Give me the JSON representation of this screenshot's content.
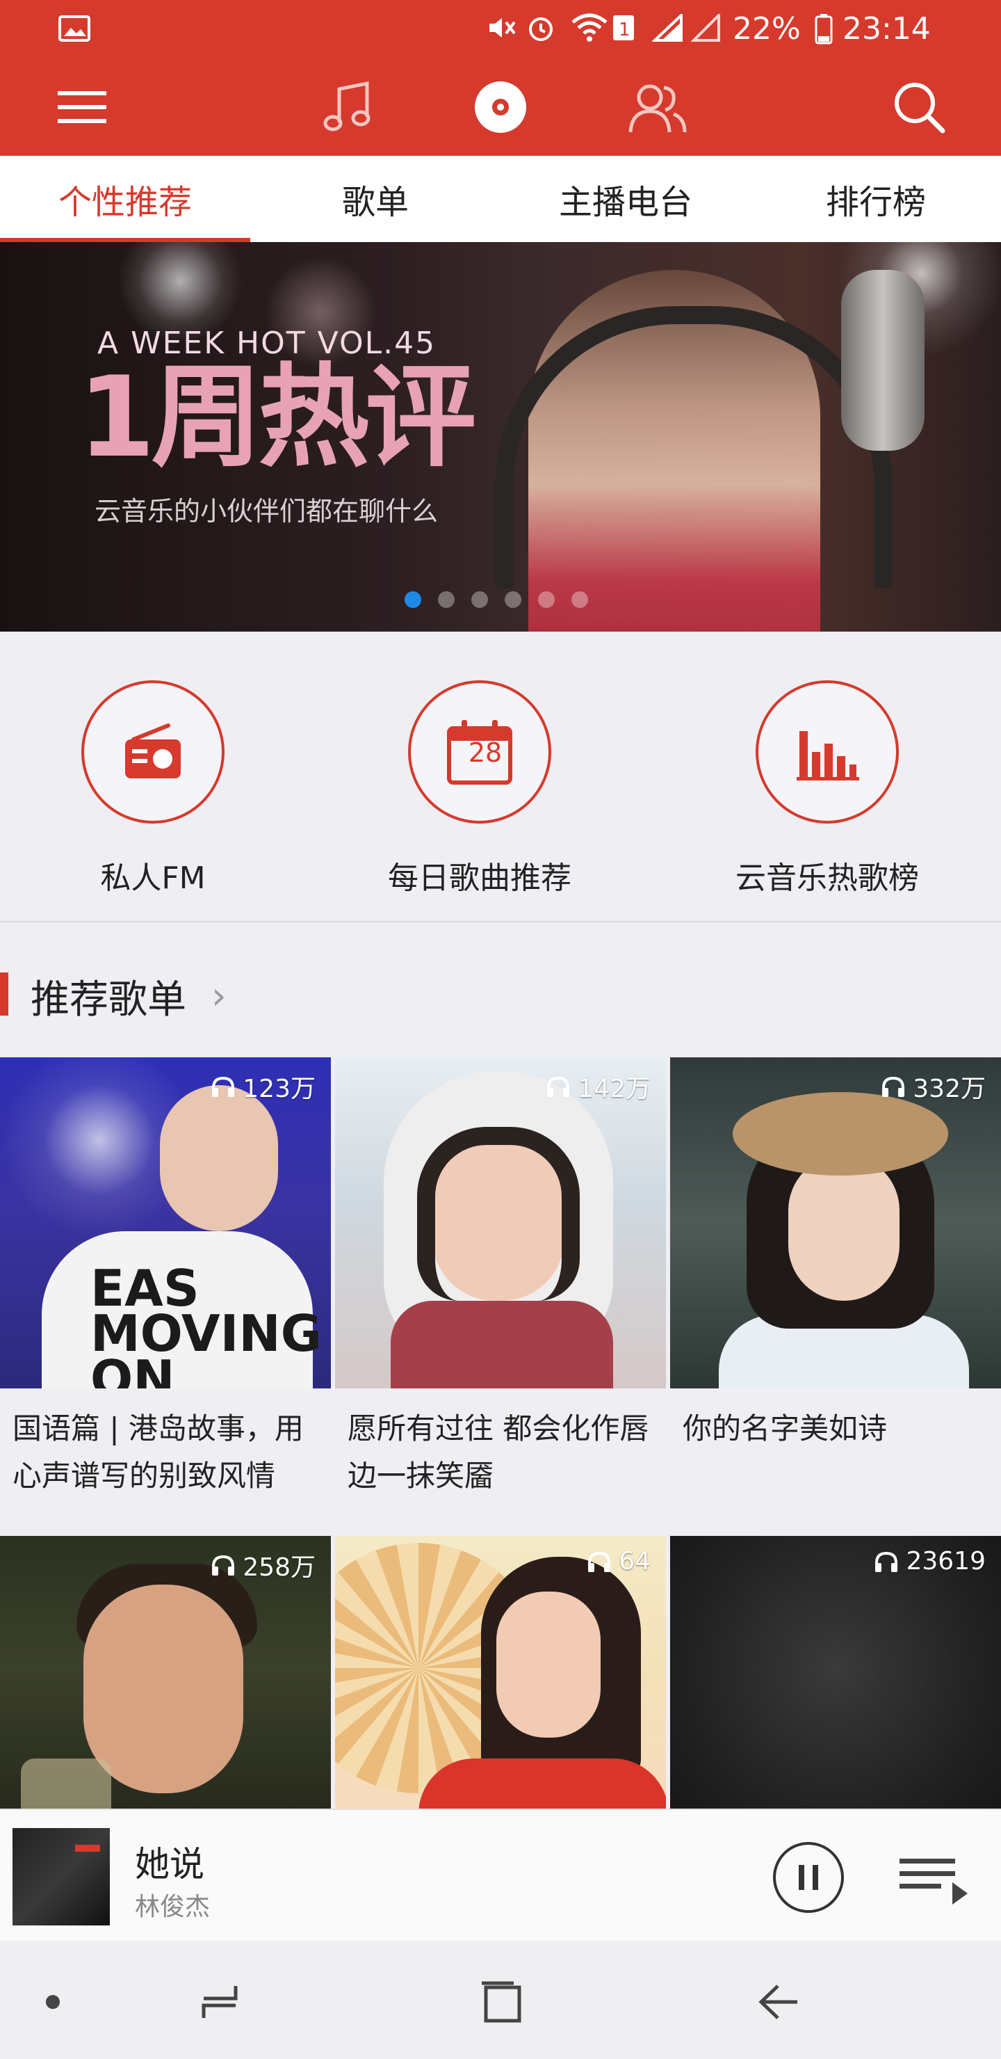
{
  "status_bar": {
    "battery_text": "22%",
    "time": "23:14",
    "icons": [
      "gallery-icon",
      "mute-icon",
      "alarm-icon",
      "wifi-icon",
      "sim1-icon",
      "signal-icon",
      "signal2-icon",
      "battery-icon"
    ]
  },
  "appbar": {
    "icons": [
      "menu-icon",
      "music-note-icon",
      "disc-icon",
      "friends-icon",
      "search-icon"
    ]
  },
  "tabs": [
    {
      "label": "个性推荐",
      "active": true
    },
    {
      "label": "歌单",
      "active": false
    },
    {
      "label": "主播电台",
      "active": false
    },
    {
      "label": "排行榜",
      "active": false
    }
  ],
  "banner": {
    "vol_text": "A WEEK HOT  VOL.45",
    "headline": "1周热评",
    "subtitle": "云音乐的小伙伴们都在聊什么",
    "page_count": 6,
    "active_page": 1
  },
  "quick_actions": [
    {
      "label": "私人FM",
      "icon": "radio-icon"
    },
    {
      "label": "每日歌曲推荐",
      "icon": "calendar-icon",
      "calendar_day": "28"
    },
    {
      "label": "云音乐热歌榜",
      "icon": "chart-bars-icon"
    }
  ],
  "section": {
    "title": "推荐歌单"
  },
  "playlists": [
    {
      "plays": "123万",
      "title": "国语篇 | 港岛故事，用心声谱写的别致风情",
      "art_text": "EAS MOVING ON"
    },
    {
      "plays": "142万",
      "title": "愿所有过往 都会化作唇边一抹笑靥"
    },
    {
      "plays": "332万",
      "title": "你的名字美如诗"
    },
    {
      "plays": "258万",
      "title": ""
    },
    {
      "plays": "64",
      "title": ""
    },
    {
      "plays": "23619",
      "title": ""
    }
  ],
  "player": {
    "song": "她说",
    "artist": "林俊杰"
  },
  "colors": {
    "brand_red": "#d53a2d",
    "page_bg": "#efeef3",
    "active_dot": "#1e8ae8"
  }
}
